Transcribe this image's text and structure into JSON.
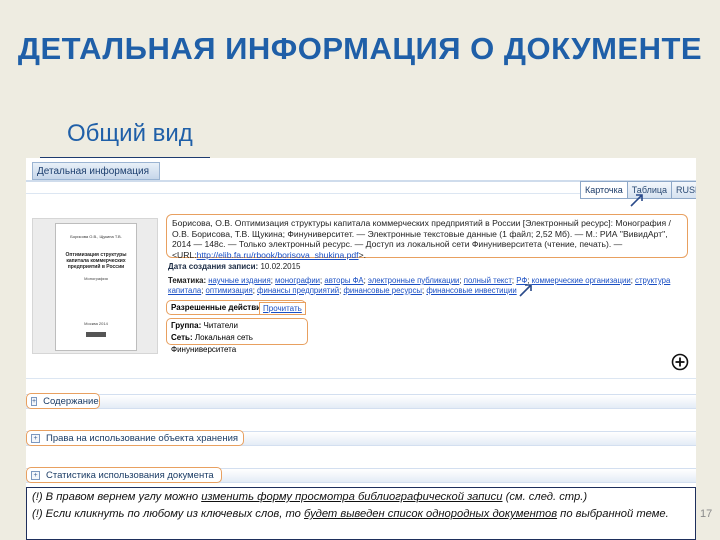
{
  "slide": {
    "title": "ДЕТАЛЬНАЯ ИНФОРМАЦИЯ О ДОКУМЕНТЕ",
    "subtitle": "Общий вид",
    "page_number": "17"
  },
  "panel": {
    "header": "Детальная информация",
    "view_tabs": [
      "Карточка",
      "Таблица",
      "RUSMARC"
    ],
    "active_tab_index": 0
  },
  "cover": {
    "authors": "Борисова О.В., Щукина Т.В.",
    "title": "Оптимизация структуры капитала коммерческих предприятий в России",
    "type": "Монография",
    "city": "Москва 2014"
  },
  "citation": {
    "text": "Борисова, О.В. Оптимизация структуры капитала коммерческих предприятий в России [Электронный ресурс]: Монография / О.В. Борисова, Т.В. Щукина; Финуниверситет. — Электронные текстовые данные (1 файл; 2,52 Мб). — М.: РИА \"ВивидАрт\", 2014 — 148с. — Только электронный ресурс. — Доступ из локальной сети Финуниверситета (чтение, печать). —",
    "url_prefix": "<URL:",
    "url": "http://elib.fa.ru/rbook/borisova_shukina.pdf",
    "url_suffix": ">."
  },
  "record": {
    "created_label": "Дата создания записи:",
    "created_value": "10.02.2015",
    "themes_label": "Тематика:",
    "themes": [
      "научные издания",
      "монографии",
      "авторы ФА",
      "электронные публикации",
      "полный текст",
      "РФ",
      "коммерческие организации",
      "структура капитала",
      "оптимизация",
      "финансы предприятий",
      "финансовые ресурсы",
      "финансовые инвестиции"
    ],
    "actions_label": "Разрешенные действия:",
    "read_action": "Прочитать",
    "group_label": "Группа:",
    "group_value": "Читатели",
    "network_label": "Сеть:",
    "network_value": "Локальная сеть Финуниверситета"
  },
  "sections": [
    "Содержание",
    "Права на использование объекта хранения",
    "Статистика использования документа"
  ],
  "note": {
    "p1_before": "(!) В правом вернем углу можно ",
    "p1_link": "изменить форму просмотра библиографической записи",
    "p1_after": " (см. след. стр.)",
    "p2_before": "(!) Если кликнуть по любому из ключевых слов, то ",
    "p2_link": "будет выведен список однородных документов",
    "p2_after": " по выбранной теме."
  },
  "colors": {
    "title_blue": "#1f5fa8",
    "highlight_orange": "#e8a060",
    "link_blue": "#1a4fc4",
    "slide_background": "#eeece1"
  }
}
